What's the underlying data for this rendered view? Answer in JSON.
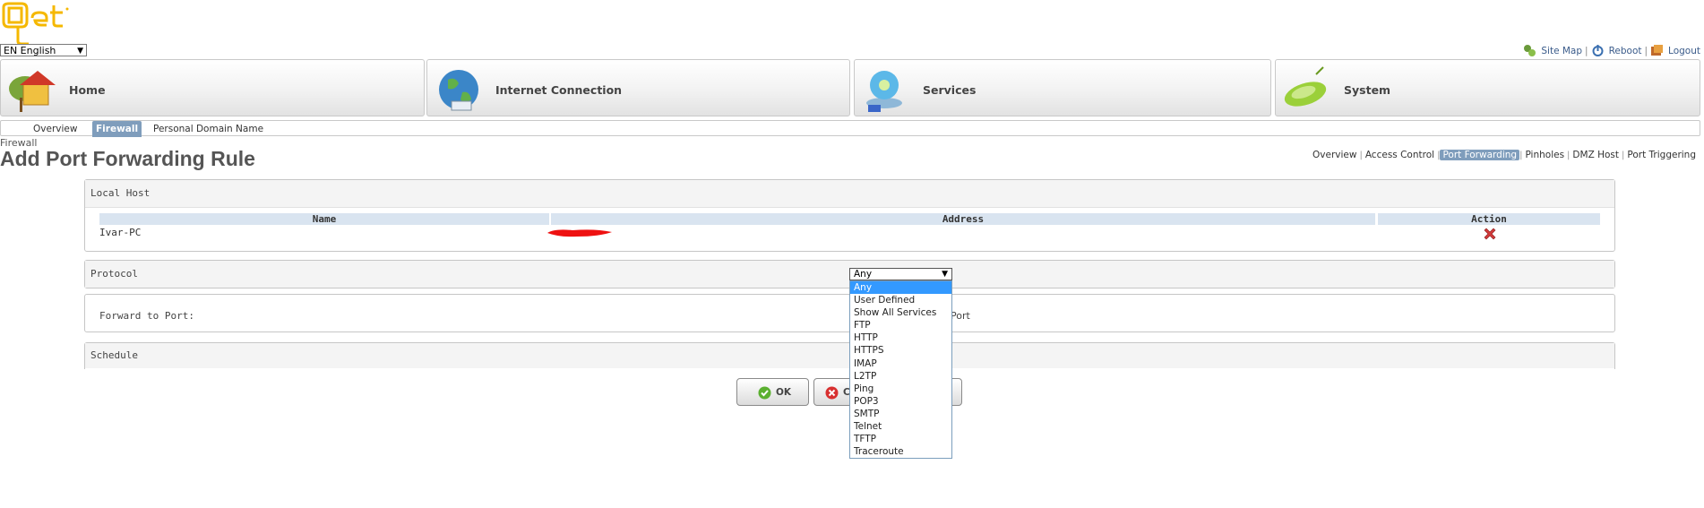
{
  "brand": {
    "logo_text": "Qet"
  },
  "language": {
    "value": "EN English"
  },
  "top_links": [
    {
      "label": "Site Map",
      "icon": "sitemap-icon"
    },
    {
      "label": "Reboot",
      "icon": "power-icon"
    },
    {
      "label": "Logout",
      "icon": "logout-icon"
    }
  ],
  "nav": {
    "tabs": [
      {
        "label": "Home",
        "icon": "home-icon"
      },
      {
        "label": "Internet Connection",
        "icon": "globe-icon"
      },
      {
        "label": "Services",
        "icon": "disc-icon"
      },
      {
        "label": "System",
        "icon": "router-icon"
      }
    ]
  },
  "subnav": {
    "items": [
      "Overview",
      "Firewall",
      "Personal Domain Name"
    ],
    "active": "Firewall"
  },
  "breadcrumb": "Firewall",
  "page_title": "Add Port Forwarding Rule",
  "section_nav": {
    "items": [
      "Overview",
      "Access Control",
      "Port Forwarding",
      "Pinholes",
      "DMZ Host",
      "Port Triggering"
    ],
    "active": "Port Forwarding"
  },
  "local_host": {
    "title": "Local Host",
    "columns": [
      "Name",
      "Address",
      "Action"
    ],
    "rows": [
      {
        "name": "Ivar-PC",
        "address": "[redacted]",
        "action": "delete"
      }
    ]
  },
  "protocol": {
    "label": "Protocol",
    "selected": "Any",
    "options": [
      "Any",
      "User Defined",
      "Show All Services",
      "FTP",
      "HTTP",
      "HTTPS",
      "IMAP",
      "L2TP",
      "Ping",
      "POP3",
      "SMTP",
      "Telnet",
      "TFTP",
      "Traceroute"
    ]
  },
  "forward": {
    "label": "Forward to Port:",
    "partial_text": "Port"
  },
  "schedule": {
    "label": "Schedule"
  },
  "buttons": {
    "ok": "OK",
    "cancel_partial": "C"
  },
  "colors": {
    "accent": "#7f9dbc",
    "table_header": "#d9e4f0",
    "dropdown_highlight": "#3399ff",
    "logo": "#f5b800"
  }
}
